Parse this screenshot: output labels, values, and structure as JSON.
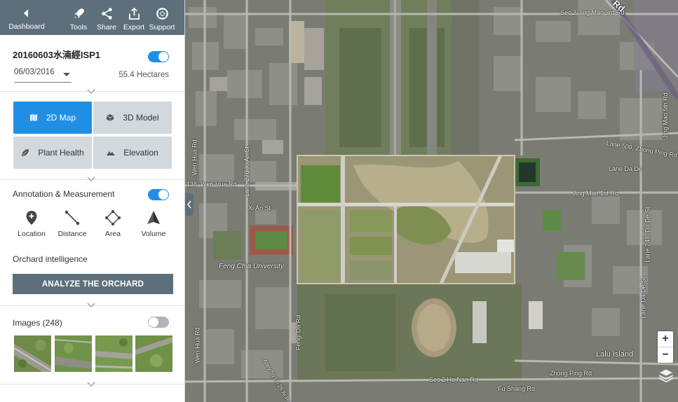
{
  "toolbar": {
    "back_label": "Dashboard",
    "tools_label": "Tools",
    "share_label": "Share",
    "export_label": "Export",
    "support_label": "Support"
  },
  "project": {
    "name": "20160603水湳經ISP1",
    "visible": true,
    "date": "06/03/2016",
    "area": "55.4 Hectares"
  },
  "views": [
    {
      "label": "2D Map",
      "icon": "map-icon",
      "active": true
    },
    {
      "label": "3D Model",
      "icon": "cube-icon",
      "active": false
    },
    {
      "label": "Plant Health",
      "icon": "leaf-icon",
      "active": false
    },
    {
      "label": "Elevation",
      "icon": "mountain-icon",
      "active": false
    }
  ],
  "annotation": {
    "title": "Annotation & Measurement",
    "enabled": true,
    "tools": [
      {
        "label": "Location",
        "icon": "location-pin-icon"
      },
      {
        "label": "Distance",
        "icon": "ruler-line-icon"
      },
      {
        "label": "Area",
        "icon": "polygon-icon"
      },
      {
        "label": "Volume",
        "icon": "pyramid-icon"
      }
    ]
  },
  "orchard": {
    "title": "Orchard intelligence",
    "button": "ANALYZE THE ORCHARD"
  },
  "images": {
    "title": "Images (248)",
    "enabled": false,
    "thumbnail_count": 4
  },
  "map": {
    "labels": {
      "sec2_jing_mao": "Sec 2 Jing Mao 3rd Rd",
      "rd_top_right": "Rd",
      "wen_hua_vertical": "Wen Hua Rd",
      "lane270": "Lane 270 Xi An St",
      "wen_hua_138": "138, Wen Hua Rd",
      "xi_an_st": "Xi An St",
      "feng_chia": "Feng Chia University",
      "lane509": "Lane 509, Zhong Ping Rd",
      "lane_da_de": "Lane Da De",
      "jing_mao_1st": "Jing Mao 1st Rd",
      "lane248": "Lane 248, Da De St",
      "lane_da_de_st": "Lane Da De St",
      "fengi_da_rd": "Fengi Da Rd",
      "wen_hua_lower": "Wen Hua Rd",
      "lalu_island": "Lalu Island",
      "zhong_ping_rd": "Zhong Ping Rd",
      "sec2_he_nan": "Sec 2 He Nan Rd",
      "fu_shang_rd": "Fu Shang Rd",
      "alley": "Alley 55 Ln 26 Ai Rd",
      "jing_mao_5th": "Jing Mao 5th Rd"
    },
    "zoom_in": "+",
    "zoom_out": "−"
  }
}
